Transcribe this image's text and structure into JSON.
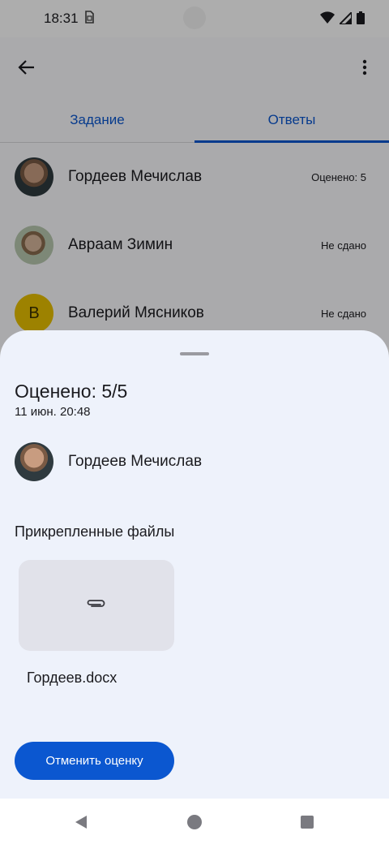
{
  "status_bar": {
    "time": "18:31",
    "sim_icon": "sim-card-icon"
  },
  "app_bar": {
    "back_icon": "arrow-back-icon",
    "more_icon": "more-vert-icon"
  },
  "tabs": [
    {
      "label": "Задание",
      "active": false
    },
    {
      "label": "Ответы",
      "active": true
    }
  ],
  "students": [
    {
      "name": "Гордеев Мечислав",
      "status": "Оценено: 5"
    },
    {
      "name": "Авраам Зимин",
      "status": "Не сдано"
    },
    {
      "name": "Валерий Мясников",
      "status": "Не сдано",
      "initial": "В"
    }
  ],
  "sheet": {
    "title": "Оценено: 5/5",
    "date": "11 июн. 20:48",
    "student_name": "Гордеев Мечислав",
    "files_title": "Прикрепленные файлы",
    "file_name": "Гордеев.docx",
    "file_icon": "paperclip-icon",
    "cancel_label": "Отменить оценку"
  },
  "colors": {
    "accent": "#0b57d0",
    "sheet_bg": "#eef2fb",
    "avatar_letter_bg": "#e8c000"
  }
}
